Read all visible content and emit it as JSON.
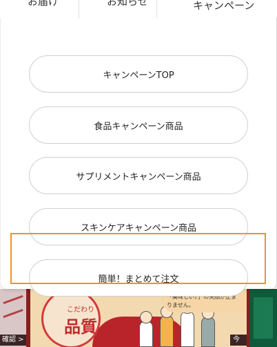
{
  "tabs": [
    {
      "label": "お届け"
    },
    {
      "label": "お知らせ"
    },
    {
      "label": "キャンペーン"
    }
  ],
  "menu": {
    "items": [
      {
        "label": "キャンペーンTOP"
      },
      {
        "label": "食品キャンペーン商品"
      },
      {
        "label": "サプリメントキャンペーン商品"
      },
      {
        "label": "スキンケアキャンペーン商品"
      },
      {
        "label": "簡単！まとめて注文"
      }
    ],
    "highlighted_index": 4,
    "highlight_color": "#f0902a"
  },
  "banner": {
    "stamp_small": "こだわり",
    "stamp_big": "品質",
    "bubble_text": "「美味しい♪」の笑顔が止まりません。",
    "cta_right": "今すぐ確認 >",
    "cta_left": "確認 >"
  }
}
